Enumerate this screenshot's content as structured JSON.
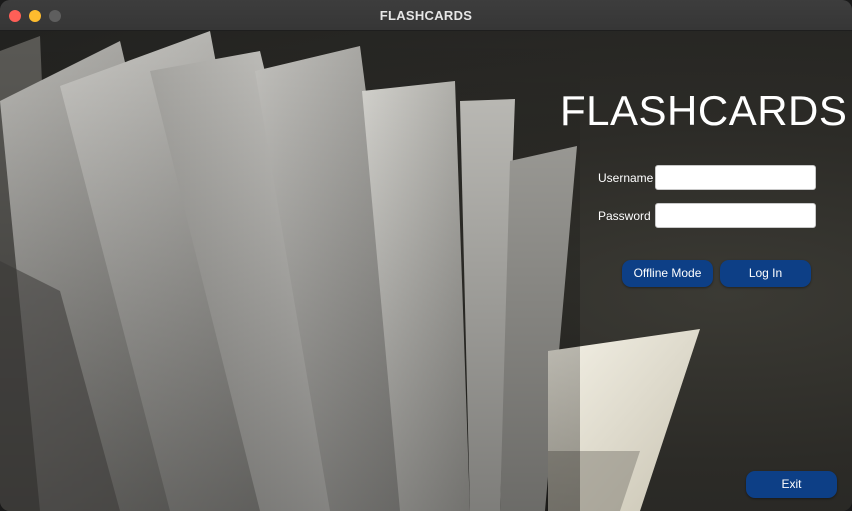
{
  "window": {
    "title": "FLASHCARDS",
    "controls": [
      "close",
      "minimize",
      "maximize"
    ]
  },
  "login": {
    "app_title": "FLASHCARDS",
    "username_label": "Username",
    "username_value": "",
    "password_label": "Password",
    "password_value": "",
    "offline_button": "Offline Mode",
    "login_button": "Log In"
  },
  "footer": {
    "exit_button": "Exit"
  },
  "colors": {
    "button": "#0d3f86",
    "title_text": "#ffffff",
    "background": "#2c2b27"
  },
  "background_image": {
    "icon": "fanned-paper-pages-photo"
  }
}
